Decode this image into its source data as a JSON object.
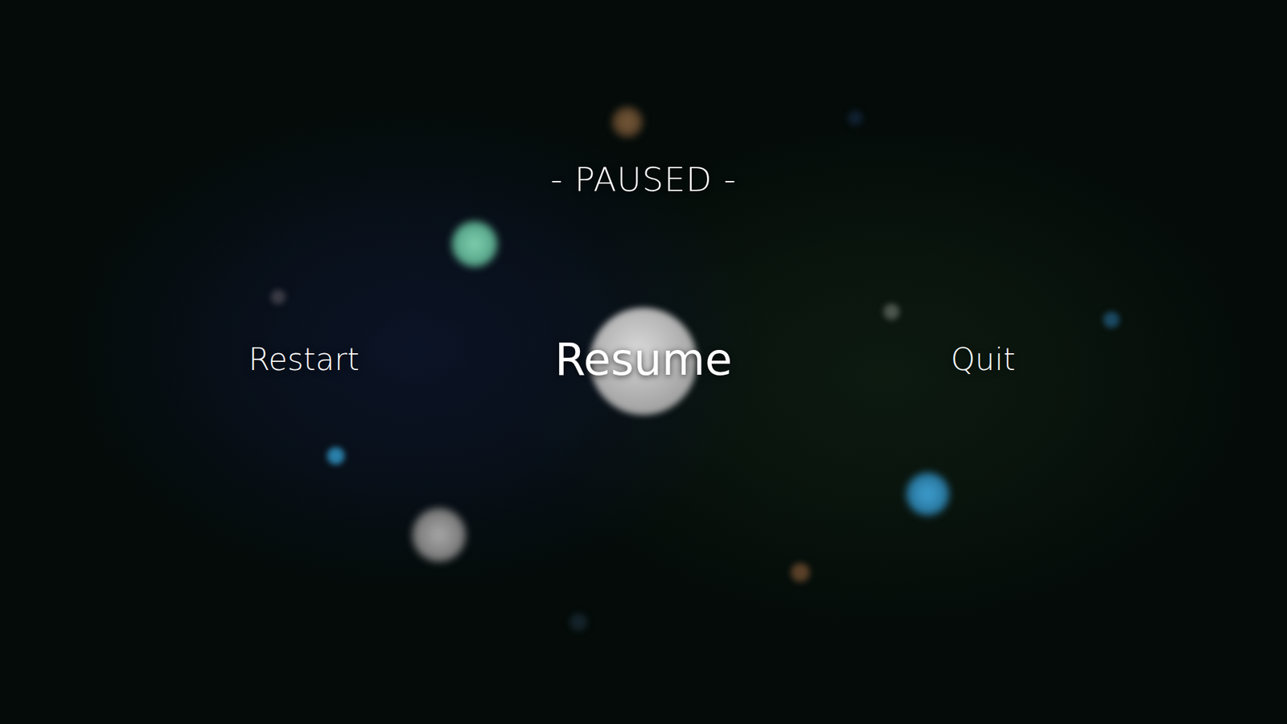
{
  "title": "- PAUSED -",
  "menu": [
    {
      "label": "Restart",
      "selected": false
    },
    {
      "label": "Resume",
      "selected": true
    },
    {
      "label": "Quit",
      "selected": false
    }
  ]
}
